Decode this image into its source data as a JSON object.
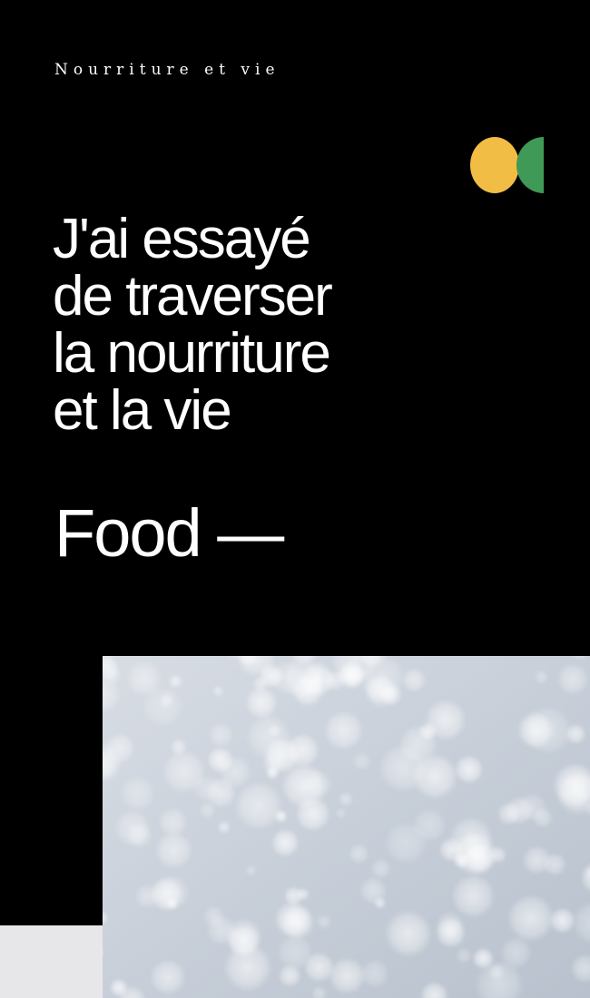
{
  "header": {
    "brand_text": "Nourriture et vie"
  },
  "logo": {
    "icon": "two-shapes-logo-icon",
    "colors": {
      "circle": "#f1bd45",
      "half_circle": "#3f9a57"
    }
  },
  "hero": {
    "headline_lines": [
      "J'ai essayé",
      "de traverser",
      "la nourriture",
      "et la vie"
    ],
    "subtitle": "Food —"
  },
  "colors": {
    "background": "#000000",
    "text": "#ffffff",
    "strip": "#e7e7e9"
  },
  "image": {
    "description_icon": "bokeh-photo-icon"
  }
}
